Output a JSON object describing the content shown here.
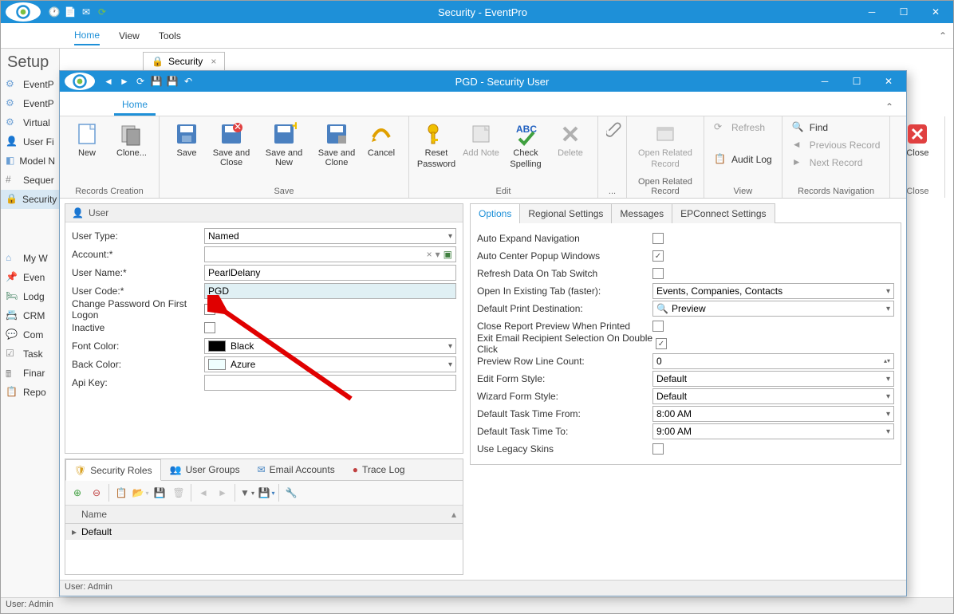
{
  "outer": {
    "title": "Security - EventPro",
    "menu": {
      "home": "Home",
      "view": "View",
      "tools": "Tools"
    },
    "setup": "Setup",
    "doc_tab": "Security",
    "nav": [
      "EventP",
      "EventP",
      "Virtual",
      "User Fi",
      "Model N",
      "Sequer",
      "Security"
    ],
    "nav2": [
      "My W",
      "Even",
      "Lodg",
      "CRM",
      "Com",
      "Task",
      "Finar",
      "Repo"
    ],
    "status": "User: Admin"
  },
  "dialog": {
    "title": "PGD - Security User",
    "tab_home": "Home",
    "ribbon": {
      "new": "New",
      "clone": "Clone...",
      "save": "Save",
      "save_close": "Save and Close",
      "save_new": "Save and New",
      "save_clone": "Save and Clone",
      "cancel": "Cancel",
      "reset_pw1": "Reset",
      "reset_pw2": "Password",
      "add_note": "Add Note",
      "check_sp1": "Check",
      "check_sp2": "Spelling",
      "delete": "Delete",
      "orr1": "Open Related",
      "orr2": "Record",
      "refresh": "Refresh",
      "audit": "Audit Log",
      "find": "Find",
      "prev": "Previous Record",
      "next": "Next Record",
      "close": "Close",
      "grp_rc": "Records Creation",
      "grp_save": "Save",
      "grp_edit": "Edit",
      "grp_dots": "...",
      "grp_orr": "Open Related Record",
      "grp_view": "View",
      "grp_nav": "Records Navigation",
      "grp_close": "Close"
    },
    "user_hdr": "User",
    "form": {
      "user_type_lbl": "User Type:",
      "user_type_val": "Named",
      "account_lbl": "Account:*",
      "account_val": "",
      "user_name_lbl": "User Name:*",
      "user_name_val": "PearlDelany",
      "user_code_lbl": "User Code:*",
      "user_code_val": "PGD",
      "cpfl_lbl": "Change Password On First Logon",
      "inactive_lbl": "Inactive",
      "font_color_lbl": "Font Color:",
      "font_color_val": "Black",
      "back_color_lbl": "Back Color:",
      "back_color_val": "Azure",
      "api_key_lbl": "Api Key:"
    },
    "opt_tabs": {
      "options": "Options",
      "regional": "Regional Settings",
      "messages": "Messages",
      "epc": "EPConnect Settings"
    },
    "opts": {
      "auto_expand": "Auto Expand Navigation",
      "auto_center": "Auto Center Popup Windows",
      "refresh_tab": "Refresh Data On Tab Switch",
      "open_existing": "Open In Existing Tab (faster):",
      "open_existing_val": "Events, Companies, Contacts",
      "print_dest": "Default Print Destination:",
      "print_dest_val": "Preview",
      "close_report": "Close Report Preview When Printed",
      "exit_email": "Exit Email Recipient Selection On Double Click",
      "row_count": "Preview Row Line Count:",
      "row_count_val": "0",
      "edit_style": "Edit Form Style:",
      "edit_style_val": "Default",
      "wizard_style": "Wizard Form Style:",
      "wizard_style_val": "Default",
      "task_from": "Default Task Time From:",
      "task_from_val": "8:00 AM",
      "task_to": "Default Task Time To:",
      "task_to_val": "9:00 AM",
      "legacy": "Use Legacy Skins"
    },
    "btabs": {
      "roles": "Security Roles",
      "groups": "User Groups",
      "email": "Email Accounts",
      "trace": "Trace Log"
    },
    "grid": {
      "name_col": "Name",
      "row0": "Default"
    },
    "status": "User: Admin"
  }
}
